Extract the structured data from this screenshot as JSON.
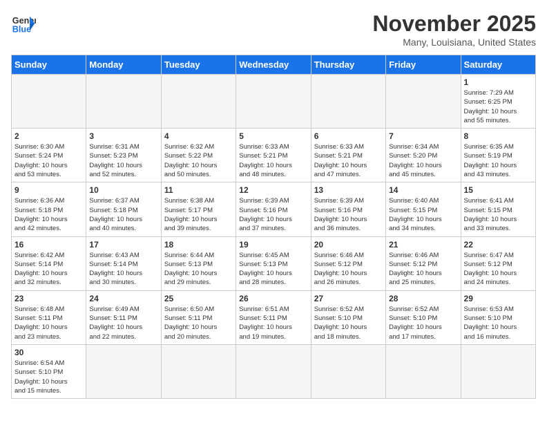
{
  "logo": {
    "line1": "General",
    "line2": "Blue"
  },
  "title": "November 2025",
  "location": "Many, Louisiana, United States",
  "days_of_week": [
    "Sunday",
    "Monday",
    "Tuesday",
    "Wednesday",
    "Thursday",
    "Friday",
    "Saturday"
  ],
  "weeks": [
    [
      {
        "day": "",
        "info": ""
      },
      {
        "day": "",
        "info": ""
      },
      {
        "day": "",
        "info": ""
      },
      {
        "day": "",
        "info": ""
      },
      {
        "day": "",
        "info": ""
      },
      {
        "day": "",
        "info": ""
      },
      {
        "day": "1",
        "info": "Sunrise: 7:29 AM\nSunset: 6:25 PM\nDaylight: 10 hours\nand 55 minutes."
      }
    ],
    [
      {
        "day": "2",
        "info": "Sunrise: 6:30 AM\nSunset: 5:24 PM\nDaylight: 10 hours\nand 53 minutes."
      },
      {
        "day": "3",
        "info": "Sunrise: 6:31 AM\nSunset: 5:23 PM\nDaylight: 10 hours\nand 52 minutes."
      },
      {
        "day": "4",
        "info": "Sunrise: 6:32 AM\nSunset: 5:22 PM\nDaylight: 10 hours\nand 50 minutes."
      },
      {
        "day": "5",
        "info": "Sunrise: 6:33 AM\nSunset: 5:21 PM\nDaylight: 10 hours\nand 48 minutes."
      },
      {
        "day": "6",
        "info": "Sunrise: 6:33 AM\nSunset: 5:21 PM\nDaylight: 10 hours\nand 47 minutes."
      },
      {
        "day": "7",
        "info": "Sunrise: 6:34 AM\nSunset: 5:20 PM\nDaylight: 10 hours\nand 45 minutes."
      },
      {
        "day": "8",
        "info": "Sunrise: 6:35 AM\nSunset: 5:19 PM\nDaylight: 10 hours\nand 43 minutes."
      }
    ],
    [
      {
        "day": "9",
        "info": "Sunrise: 6:36 AM\nSunset: 5:18 PM\nDaylight: 10 hours\nand 42 minutes."
      },
      {
        "day": "10",
        "info": "Sunrise: 6:37 AM\nSunset: 5:18 PM\nDaylight: 10 hours\nand 40 minutes."
      },
      {
        "day": "11",
        "info": "Sunrise: 6:38 AM\nSunset: 5:17 PM\nDaylight: 10 hours\nand 39 minutes."
      },
      {
        "day": "12",
        "info": "Sunrise: 6:39 AM\nSunset: 5:16 PM\nDaylight: 10 hours\nand 37 minutes."
      },
      {
        "day": "13",
        "info": "Sunrise: 6:39 AM\nSunset: 5:16 PM\nDaylight: 10 hours\nand 36 minutes."
      },
      {
        "day": "14",
        "info": "Sunrise: 6:40 AM\nSunset: 5:15 PM\nDaylight: 10 hours\nand 34 minutes."
      },
      {
        "day": "15",
        "info": "Sunrise: 6:41 AM\nSunset: 5:15 PM\nDaylight: 10 hours\nand 33 minutes."
      }
    ],
    [
      {
        "day": "16",
        "info": "Sunrise: 6:42 AM\nSunset: 5:14 PM\nDaylight: 10 hours\nand 32 minutes."
      },
      {
        "day": "17",
        "info": "Sunrise: 6:43 AM\nSunset: 5:14 PM\nDaylight: 10 hours\nand 30 minutes."
      },
      {
        "day": "18",
        "info": "Sunrise: 6:44 AM\nSunset: 5:13 PM\nDaylight: 10 hours\nand 29 minutes."
      },
      {
        "day": "19",
        "info": "Sunrise: 6:45 AM\nSunset: 5:13 PM\nDaylight: 10 hours\nand 28 minutes."
      },
      {
        "day": "20",
        "info": "Sunrise: 6:46 AM\nSunset: 5:12 PM\nDaylight: 10 hours\nand 26 minutes."
      },
      {
        "day": "21",
        "info": "Sunrise: 6:46 AM\nSunset: 5:12 PM\nDaylight: 10 hours\nand 25 minutes."
      },
      {
        "day": "22",
        "info": "Sunrise: 6:47 AM\nSunset: 5:12 PM\nDaylight: 10 hours\nand 24 minutes."
      }
    ],
    [
      {
        "day": "23",
        "info": "Sunrise: 6:48 AM\nSunset: 5:11 PM\nDaylight: 10 hours\nand 23 minutes."
      },
      {
        "day": "24",
        "info": "Sunrise: 6:49 AM\nSunset: 5:11 PM\nDaylight: 10 hours\nand 22 minutes."
      },
      {
        "day": "25",
        "info": "Sunrise: 6:50 AM\nSunset: 5:11 PM\nDaylight: 10 hours\nand 20 minutes."
      },
      {
        "day": "26",
        "info": "Sunrise: 6:51 AM\nSunset: 5:11 PM\nDaylight: 10 hours\nand 19 minutes."
      },
      {
        "day": "27",
        "info": "Sunrise: 6:52 AM\nSunset: 5:10 PM\nDaylight: 10 hours\nand 18 minutes."
      },
      {
        "day": "28",
        "info": "Sunrise: 6:52 AM\nSunset: 5:10 PM\nDaylight: 10 hours\nand 17 minutes."
      },
      {
        "day": "29",
        "info": "Sunrise: 6:53 AM\nSunset: 5:10 PM\nDaylight: 10 hours\nand 16 minutes."
      }
    ],
    [
      {
        "day": "30",
        "info": "Sunrise: 6:54 AM\nSunset: 5:10 PM\nDaylight: 10 hours\nand 15 minutes."
      },
      {
        "day": "",
        "info": ""
      },
      {
        "day": "",
        "info": ""
      },
      {
        "day": "",
        "info": ""
      },
      {
        "day": "",
        "info": ""
      },
      {
        "day": "",
        "info": ""
      },
      {
        "day": "",
        "info": ""
      }
    ]
  ]
}
